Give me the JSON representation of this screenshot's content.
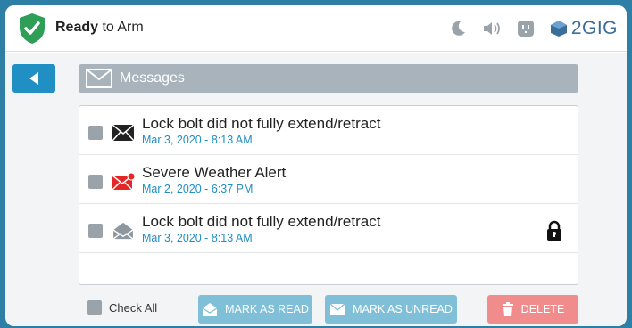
{
  "status": {
    "bold": "Ready",
    "rest": " to Arm"
  },
  "brand": "2GIG",
  "top_icons": [
    "moon-icon",
    "speaker-icon",
    "outlet-icon"
  ],
  "header": {
    "title": "Messages"
  },
  "messages": [
    {
      "title": "Lock bolt did not fully extend/retract",
      "date": "Mar 3, 2020 - 8:13 AM",
      "envelope": "closed-black",
      "locked": false
    },
    {
      "title": "Severe Weather Alert",
      "date": "Mar 2, 2020 - 6:37 PM",
      "envelope": "closed-red",
      "locked": false
    },
    {
      "title": "Lock bolt did not fully extend/retract",
      "date": "Mar 3, 2020 - 8:13 AM",
      "envelope": "open-gray",
      "locked": true
    }
  ],
  "footer": {
    "check_all": "Check All",
    "mark_read": "MARK AS READ",
    "mark_unread": "MARK AS UNREAD",
    "delete": "DELETE"
  },
  "colors": {
    "background": "#2e7fa6",
    "accent": "#1f8fc4",
    "status_green": "#2f9e57",
    "header_bar": "#a9b3bb",
    "action_button": "#7fc0d8",
    "delete_button": "#f08c8c",
    "alert_red": "#e32727"
  }
}
